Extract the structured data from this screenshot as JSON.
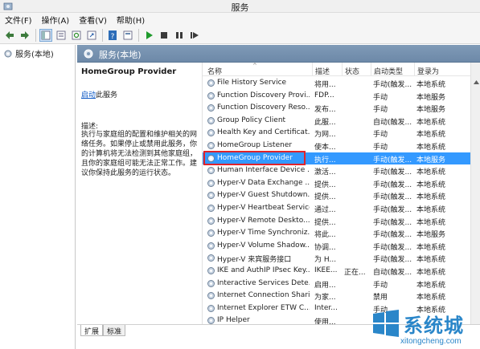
{
  "window": {
    "title": "服务"
  },
  "menu": {
    "items": [
      "文件(F)",
      "操作(A)",
      "查看(V)",
      "帮助(H)"
    ]
  },
  "toolbar": {
    "icons": [
      "back-arrow-icon",
      "forward-arrow-icon",
      "console-tree-icon",
      "list-view-icon",
      "refresh-icon",
      "export-icon",
      "help-icon",
      "properties-icon",
      "start-icon",
      "stop-icon",
      "pause-icon",
      "restart-icon"
    ]
  },
  "tree": {
    "root_label": "服务(本地)"
  },
  "header": {
    "title": "服务(本地)"
  },
  "details": {
    "service_name": "HomeGroup Provider",
    "start_link": "启动",
    "start_suffix": "此服务",
    "description_label": "描述:",
    "description_text": "执行与家庭组的配置和维护相关的网络任务。如果停止或禁用此服务，你的计算机将无法检测到其他家庭组，且你的家庭组可能无法正常工作。建议你保持此服务的运行状态。"
  },
  "columns": {
    "name": "名称",
    "description": "描述",
    "status": "状态",
    "startup_type": "启动类型",
    "logon_as": "登录为"
  },
  "services": [
    {
      "name": "File History Service",
      "desc": "将用...",
      "status": "",
      "start": "手动(触发...",
      "logon": "本地系统"
    },
    {
      "name": "Function Discovery Provi...",
      "desc": "FDP...",
      "status": "",
      "start": "手动",
      "logon": "本地服务"
    },
    {
      "name": "Function Discovery Reso...",
      "desc": "发布...",
      "status": "",
      "start": "手动",
      "logon": "本地服务"
    },
    {
      "name": "Group Policy Client",
      "desc": "此服...",
      "status": "",
      "start": "自动(触发...",
      "logon": "本地系统"
    },
    {
      "name": "Health Key and Certificat...",
      "desc": "为网...",
      "status": "",
      "start": "手动",
      "logon": "本地系统"
    },
    {
      "name": "HomeGroup Listener",
      "desc": "使本...",
      "status": "",
      "start": "手动",
      "logon": "本地系统"
    },
    {
      "name": "HomeGroup Provider",
      "desc": "执行...",
      "status": "",
      "start": "手动(触发...",
      "logon": "本地服务"
    },
    {
      "name": "Human Interface Device ...",
      "desc": "激活...",
      "status": "",
      "start": "手动(触发...",
      "logon": "本地系统"
    },
    {
      "name": "Hyper-V Data Exchange ...",
      "desc": "提供...",
      "status": "",
      "start": "手动(触发...",
      "logon": "本地系统"
    },
    {
      "name": "Hyper-V Guest Shutdown...",
      "desc": "提供...",
      "status": "",
      "start": "手动(触发...",
      "logon": "本地系统"
    },
    {
      "name": "Hyper-V Heartbeat Service",
      "desc": "通过...",
      "status": "",
      "start": "手动(触发...",
      "logon": "本地系统"
    },
    {
      "name": "Hyper-V Remote Deskto...",
      "desc": "提供...",
      "status": "",
      "start": "手动(触发...",
      "logon": "本地系统"
    },
    {
      "name": "Hyper-V Time Synchroniz...",
      "desc": "将此...",
      "status": "",
      "start": "手动(触发...",
      "logon": "本地服务"
    },
    {
      "name": "Hyper-V Volume Shadow...",
      "desc": "协调...",
      "status": "",
      "start": "手动(触发...",
      "logon": "本地系统"
    },
    {
      "name": "Hyper-V 来宾服务接口",
      "desc": "为 H...",
      "status": "",
      "start": "手动(触发...",
      "logon": "本地系统"
    },
    {
      "name": "IKE and AuthIP IPsec Key...",
      "desc": "IKEE...",
      "status": "正在...",
      "start": "自动(触发...",
      "logon": "本地系统"
    },
    {
      "name": "Interactive Services Dete...",
      "desc": "启用...",
      "status": "",
      "start": "手动",
      "logon": "本地系统"
    },
    {
      "name": "Internet Connection Shari...",
      "desc": "为家...",
      "status": "",
      "start": "禁用",
      "logon": "本地系统"
    },
    {
      "name": "Internet Explorer ETW C...",
      "desc": "Inter...",
      "status": "",
      "start": "手动",
      "logon": "本地系统"
    },
    {
      "name": "IP Helper",
      "desc": "使用...",
      "status": "",
      "start": "",
      "logon": ""
    }
  ],
  "selected_index": 6,
  "tabs": [
    "扩展",
    "标准"
  ],
  "watermark": {
    "brand": "系统城",
    "url": "xitongcheng.com"
  },
  "colors": {
    "selection": "#3399ff",
    "header_band": "#7f9ab7",
    "highlight_box": "#e0232a",
    "link": "#0b57c4",
    "watermark": "#2a86c9"
  }
}
